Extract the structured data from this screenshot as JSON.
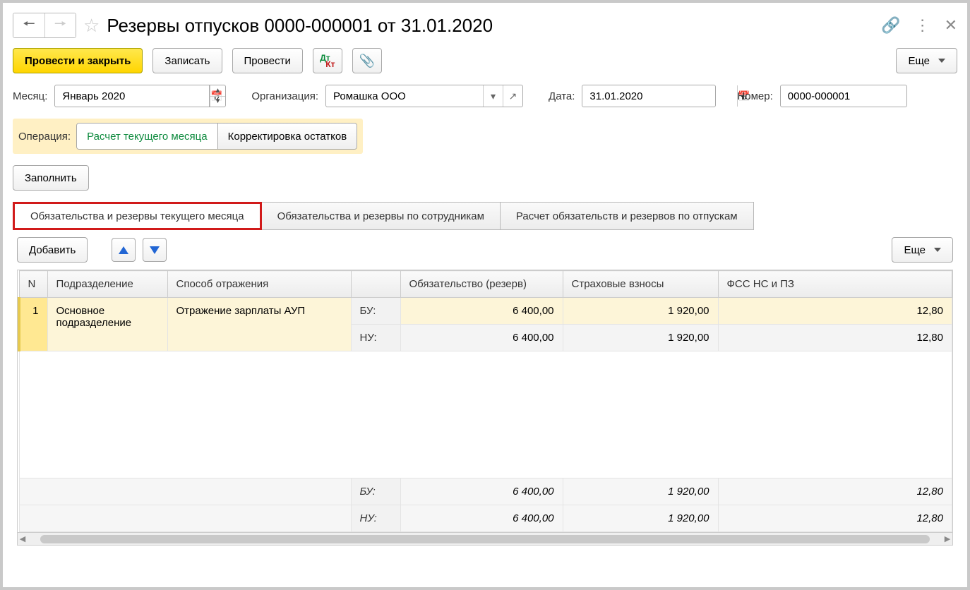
{
  "title": "Резервы отпусков 0000-000001 от 31.01.2020",
  "toolbar": {
    "post_and_close": "Провести и закрыть",
    "save": "Записать",
    "post": "Провести",
    "more": "Еще"
  },
  "fields": {
    "month_label": "Месяц:",
    "month_value": "Январь 2020",
    "org_label": "Организация:",
    "org_value": "Ромашка ООО",
    "date_label": "Дата:",
    "date_value": "31.01.2020",
    "number_label": "Номер:",
    "number_value": "0000-000001"
  },
  "operation": {
    "label": "Операция:",
    "current": "Расчет текущего месяца",
    "adjust": "Корректировка остатков"
  },
  "fill_button": "Заполнить",
  "tabs": {
    "t1": "Обязательства и резервы текущего месяца",
    "t2": "Обязательства и резервы по сотрудникам",
    "t3": "Расчет обязательств и резервов по отпускам"
  },
  "subbar": {
    "add": "Добавить",
    "more": "Еще"
  },
  "columns": {
    "n": "N",
    "dept": "Подразделение",
    "method": "Способ отражения",
    "obligation": "Обязательство (резерв)",
    "insurance": "Страховые взносы",
    "fss": "ФСС НС и ПЗ"
  },
  "row": {
    "n": "1",
    "dept": "Основное подразделение",
    "method": "Отражение зарплаты АУП",
    "bu_label": "БУ:",
    "nu_label": "НУ:",
    "bu": {
      "obligation": "6 400,00",
      "insurance": "1 920,00",
      "fss": "12,80"
    },
    "nu": {
      "obligation": "6 400,00",
      "insurance": "1 920,00",
      "fss": "12,80"
    }
  },
  "totals": {
    "bu_label": "БУ:",
    "nu_label": "НУ:",
    "bu": {
      "obligation": "6 400,00",
      "insurance": "1 920,00",
      "fss": "12,80"
    },
    "nu": {
      "obligation": "6 400,00",
      "insurance": "1 920,00",
      "fss": "12,80"
    }
  }
}
